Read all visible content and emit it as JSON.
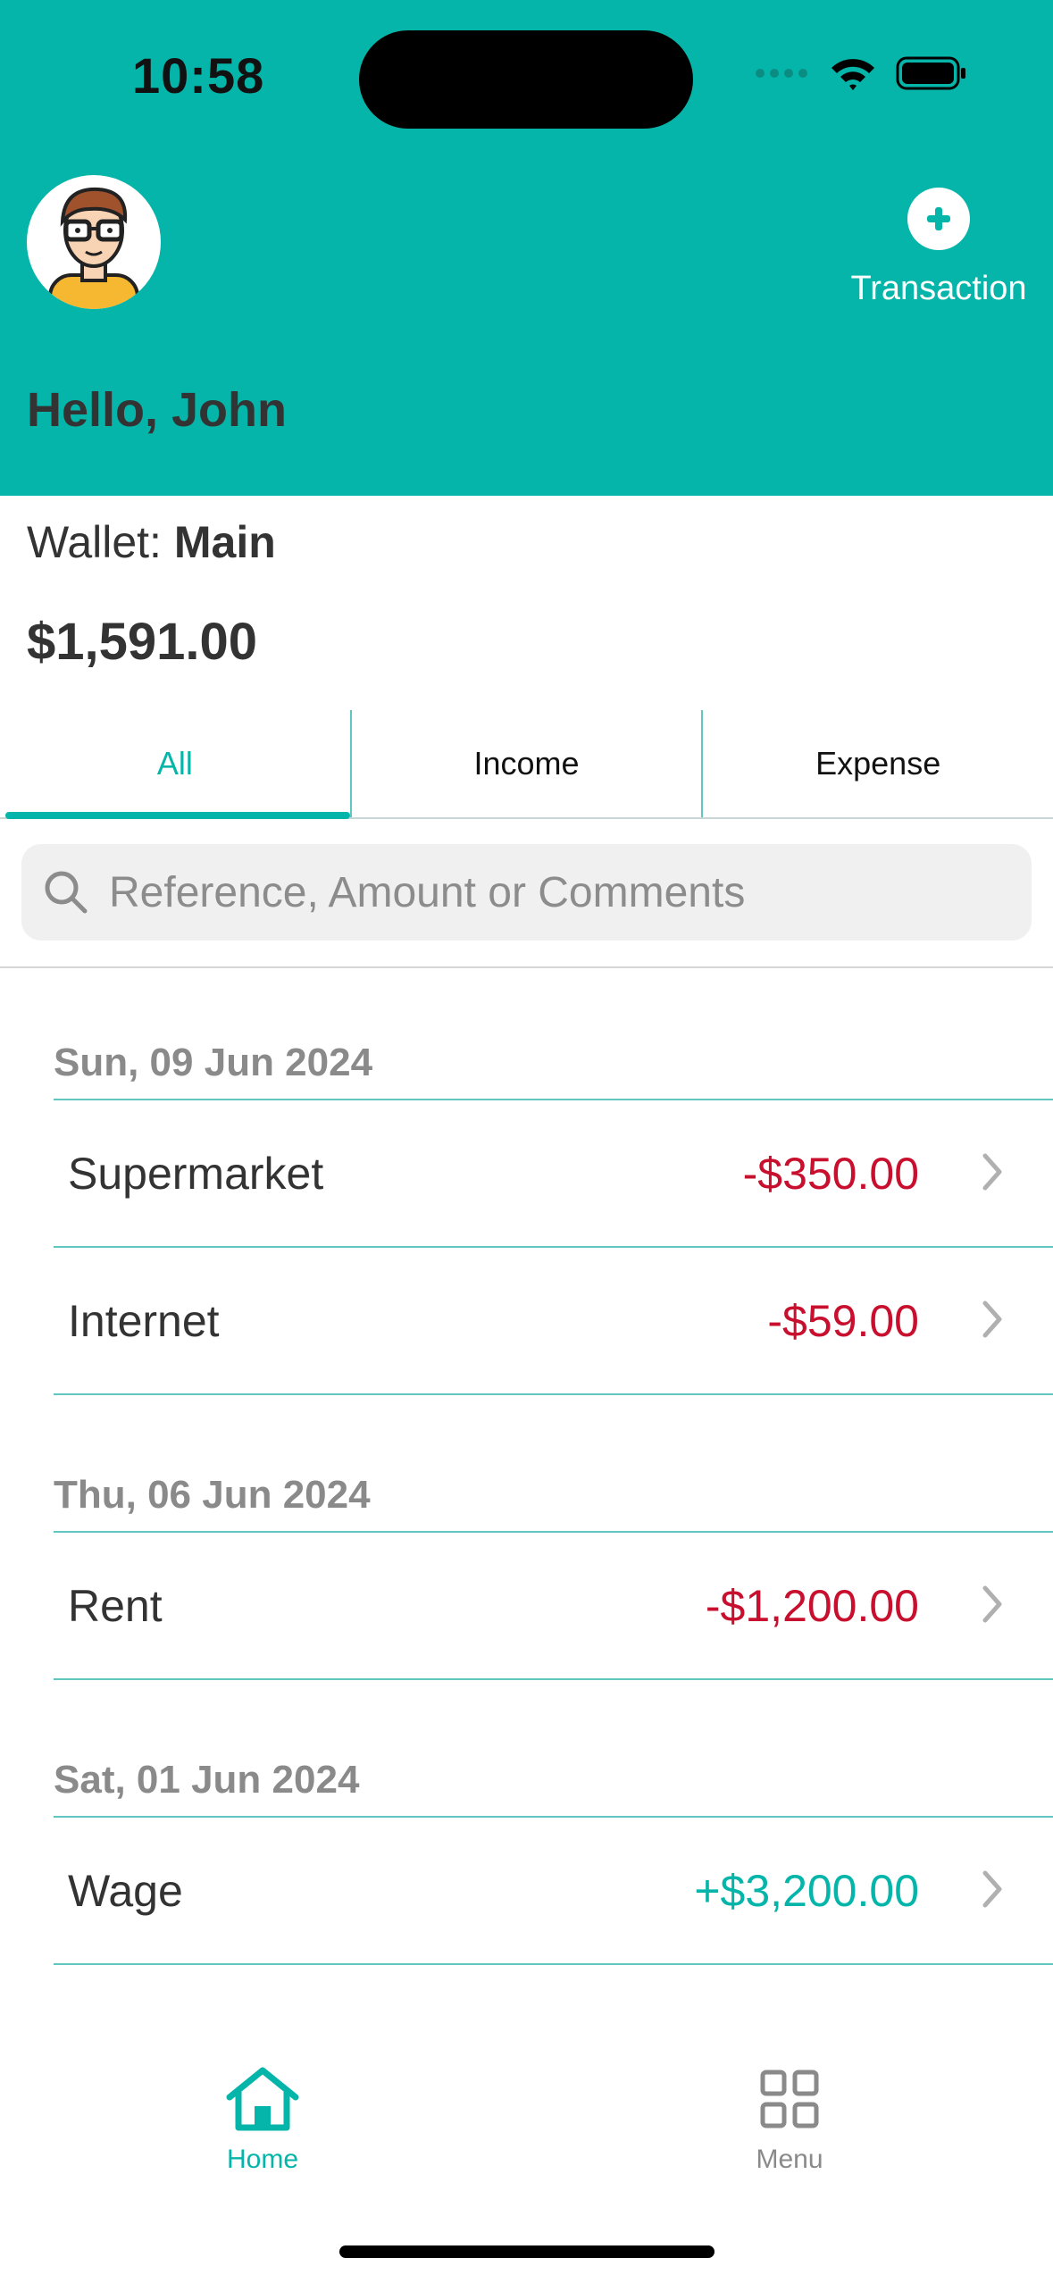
{
  "status_bar": {
    "time": "10:58"
  },
  "header": {
    "greeting": "Hello, John",
    "add_transaction_label": "Transaction",
    "background_color": "#06b5a9"
  },
  "wallet": {
    "label": "Wallet:",
    "name": "Main",
    "balance": "$1,591.00"
  },
  "tabs": [
    {
      "label": "All",
      "active": true
    },
    {
      "label": "Income",
      "active": false
    },
    {
      "label": "Expense",
      "active": false
    }
  ],
  "search": {
    "placeholder": "Reference, Amount or Comments",
    "value": ""
  },
  "groups": [
    {
      "date": "Sun, 09 Jun 2024",
      "items": [
        {
          "name": "Supermarket",
          "amount": "-$350.00",
          "type": "expense"
        },
        {
          "name": "Internet",
          "amount": "-$59.00",
          "type": "expense"
        }
      ]
    },
    {
      "date": "Thu, 06 Jun 2024",
      "items": [
        {
          "name": "Rent",
          "amount": "-$1,200.00",
          "type": "expense"
        }
      ]
    },
    {
      "date": "Sat, 01 Jun 2024",
      "items": [
        {
          "name": "Wage",
          "amount": "+$3,200.00",
          "type": "income"
        }
      ]
    }
  ],
  "nav": [
    {
      "label": "Home",
      "icon": "home-icon",
      "active": true
    },
    {
      "label": "Menu",
      "icon": "grid-icon",
      "active": false
    }
  ],
  "colors": {
    "accent": "#06b5a9",
    "expense": "#c8102e",
    "income": "#06b5a9"
  }
}
